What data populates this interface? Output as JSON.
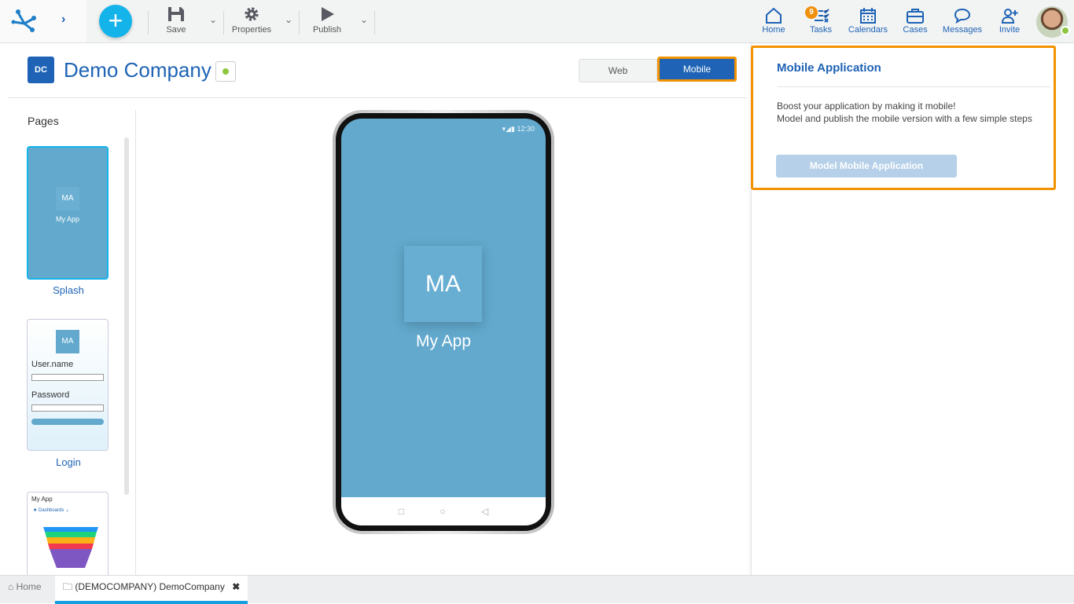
{
  "toolbar": {
    "save": "Save",
    "properties": "Properties",
    "publish": "Publish"
  },
  "nav": {
    "home": "Home",
    "tasks": "Tasks",
    "tasks_badge": "9",
    "calendars": "Calendars",
    "cases": "Cases",
    "messages": "Messages",
    "invite": "Invite"
  },
  "header": {
    "initials": "DC",
    "title": "Demo Company"
  },
  "view_toggle": {
    "web": "Web",
    "mobile": "Mobile",
    "selected": "Mobile"
  },
  "pages": {
    "title": "Pages",
    "items": [
      {
        "label": "Splash",
        "initials": "MA",
        "app": "My App"
      },
      {
        "label": "Login",
        "initials": "MA",
        "user_label": "User.name",
        "password_label": "Password"
      },
      {
        "app": "My App",
        "menu": "Dashboards"
      }
    ]
  },
  "phone": {
    "time": "12:30",
    "initials": "MA",
    "app_name": "My App"
  },
  "panel": {
    "title": "Mobile Application",
    "line1": "Boost your application by making it mobile!",
    "line2": "Model and publish the mobile version with a few simple steps",
    "button": "Model Mobile Application"
  },
  "footer": {
    "home": "Home",
    "tab": "(DEMOCOMPANY) DemoCompany"
  },
  "colors": {
    "accent": "#1e63b5",
    "highlight": "#f39200",
    "screen": "#62a9cd",
    "online": "#8dc63f"
  }
}
